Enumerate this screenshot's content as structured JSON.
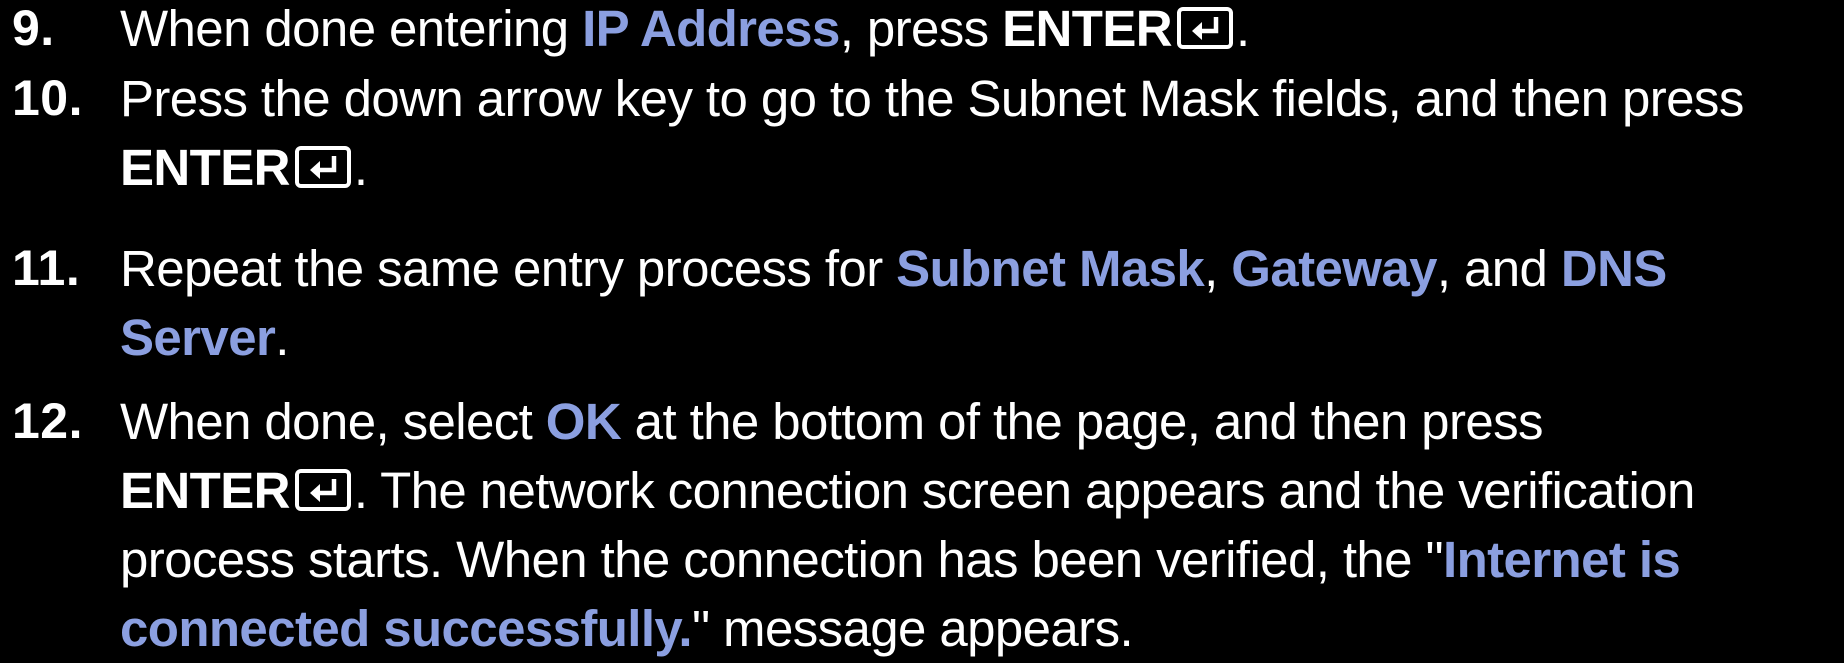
{
  "steps": [
    {
      "number": "9.",
      "lines": [
        [
          {
            "t": "When done entering ",
            "s": "plain"
          },
          {
            "t": "IP Address",
            "s": "hl"
          },
          {
            "t": ", press ",
            "s": "plain"
          },
          {
            "t": "ENTER",
            "s": "key"
          },
          {
            "icon": "enter-icon"
          },
          {
            "t": ".",
            "s": "plain"
          }
        ]
      ]
    },
    {
      "number": "10.",
      "lines": [
        [
          {
            "t": "Press the down arrow key to go to the Subnet Mask fields, and then press",
            "s": "plain"
          }
        ],
        [
          {
            "t": "ENTER",
            "s": "key"
          },
          {
            "icon": "enter-icon"
          },
          {
            "t": ".",
            "s": "plain"
          }
        ]
      ]
    },
    {
      "number": "11.",
      "lines": [
        [
          {
            "t": "Repeat the same entry process for ",
            "s": "plain"
          },
          {
            "t": "Subnet Mask",
            "s": "hl"
          },
          {
            "t": ", ",
            "s": "plain"
          },
          {
            "t": "Gateway",
            "s": "hl"
          },
          {
            "t": ", and ",
            "s": "plain"
          },
          {
            "t": "DNS",
            "s": "hl"
          }
        ],
        [
          {
            "t": "Server",
            "s": "hl"
          },
          {
            "t": ".",
            "s": "plain"
          }
        ]
      ]
    },
    {
      "number": "12.",
      "lines": [
        [
          {
            "t": "When done, select ",
            "s": "plain"
          },
          {
            "t": "OK",
            "s": "hl"
          },
          {
            "t": " at the bottom of the page, and then press",
            "s": "plain"
          }
        ],
        [
          {
            "t": "ENTER",
            "s": "key"
          },
          {
            "icon": "enter-icon"
          },
          {
            "t": ". The network connection screen appears and the verification",
            "s": "plain"
          }
        ],
        [
          {
            "t": "process starts. When the connection has been verified, the \"",
            "s": "plain"
          },
          {
            "t": "Internet is",
            "s": "hl"
          }
        ],
        [
          {
            "t": "connected successfully.",
            "s": "hl"
          },
          {
            "t": "\" message appears.",
            "s": "plain"
          }
        ]
      ]
    }
  ],
  "colors": {
    "background": "#000000",
    "text": "#ffffff",
    "highlight": "#8b9fe0"
  }
}
